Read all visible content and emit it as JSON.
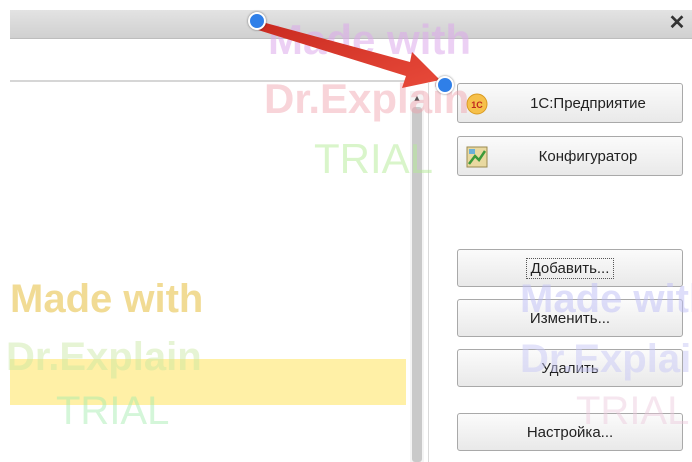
{
  "window": {
    "close_icon_glyph": "✕"
  },
  "buttons": {
    "enterprise": {
      "label": "1С:Предприятие",
      "icon": "1c-enterprise-icon",
      "icon_text": "1С"
    },
    "configurator": {
      "label": "Конфигуратор",
      "icon": "configurator-icon"
    },
    "add": {
      "label": "Добавить..."
    },
    "edit": {
      "label": "Изменить..."
    },
    "delete": {
      "label": "Удалить"
    },
    "settings": {
      "label": "Настройка..."
    }
  },
  "watermark": {
    "line1": "Made with",
    "line2": "Dr.Explain",
    "line3": "TRIAL"
  },
  "colors": {
    "accent_marker": "#2f7fe8",
    "arrow": "#e0392b",
    "selected_row": "#fff0a6"
  }
}
